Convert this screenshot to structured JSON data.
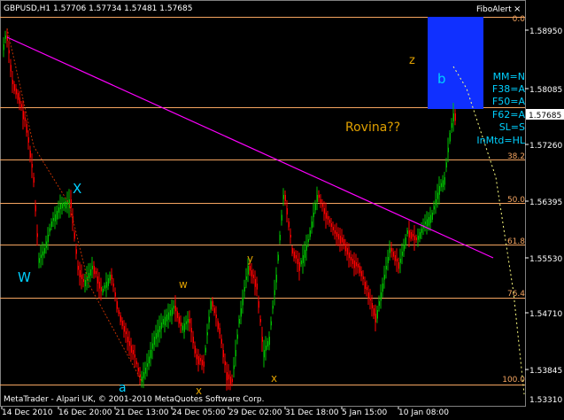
{
  "header": {
    "symbol_info": "GBPUSD,H1  1.57706 1.57734 1.57481 1.57685",
    "fibo_alert_title": "FiboAlert",
    "fibo_alert_close": "×"
  },
  "footer": {
    "copyright": "MetaTrader - Alpari UK, © 2001-2010 MetaQuotes Software Corp."
  },
  "price_axis": {
    "ticks": [
      "1.58950",
      "1.58085",
      "1.57260",
      "1.56395",
      "1.55530",
      "1.54710",
      "1.53845"
    ],
    "current_price": "1.57685",
    "bottom_price": "1.53310"
  },
  "time_axis": {
    "labels": [
      "14 Dec 2010",
      "16 Dec 20:00",
      "21 Dec 13:00",
      "24 Dec 05:00",
      "29 Dec 02:00",
      "31 Dec 18:00",
      "5 Jan 15:00",
      "10 Jan 08:00"
    ]
  },
  "fibo_levels": [
    "0.0",
    "38.2",
    "50.0",
    "61.8",
    "76.4",
    "100.0"
  ],
  "wave_labels": {
    "W": "W",
    "X": "X",
    "a": "a",
    "w": "w",
    "x": "x",
    "y": "y",
    "x2": "x",
    "z": "z",
    "b": "b"
  },
  "annotation": "Rovina??",
  "fibo_panel": [
    "MM=N",
    "F38=A",
    "F50=A",
    "F62=A",
    "SL=S",
    "InMtd=HL"
  ],
  "colors": {
    "background": "#000000",
    "bull": "#00c000",
    "bear": "#ff0000",
    "fibo": "#f4a460",
    "trendline": "#ff00ff",
    "wave_cyan": "#00d0ff",
    "wave_orange": "#e0a000",
    "box": "#1030ff"
  }
}
